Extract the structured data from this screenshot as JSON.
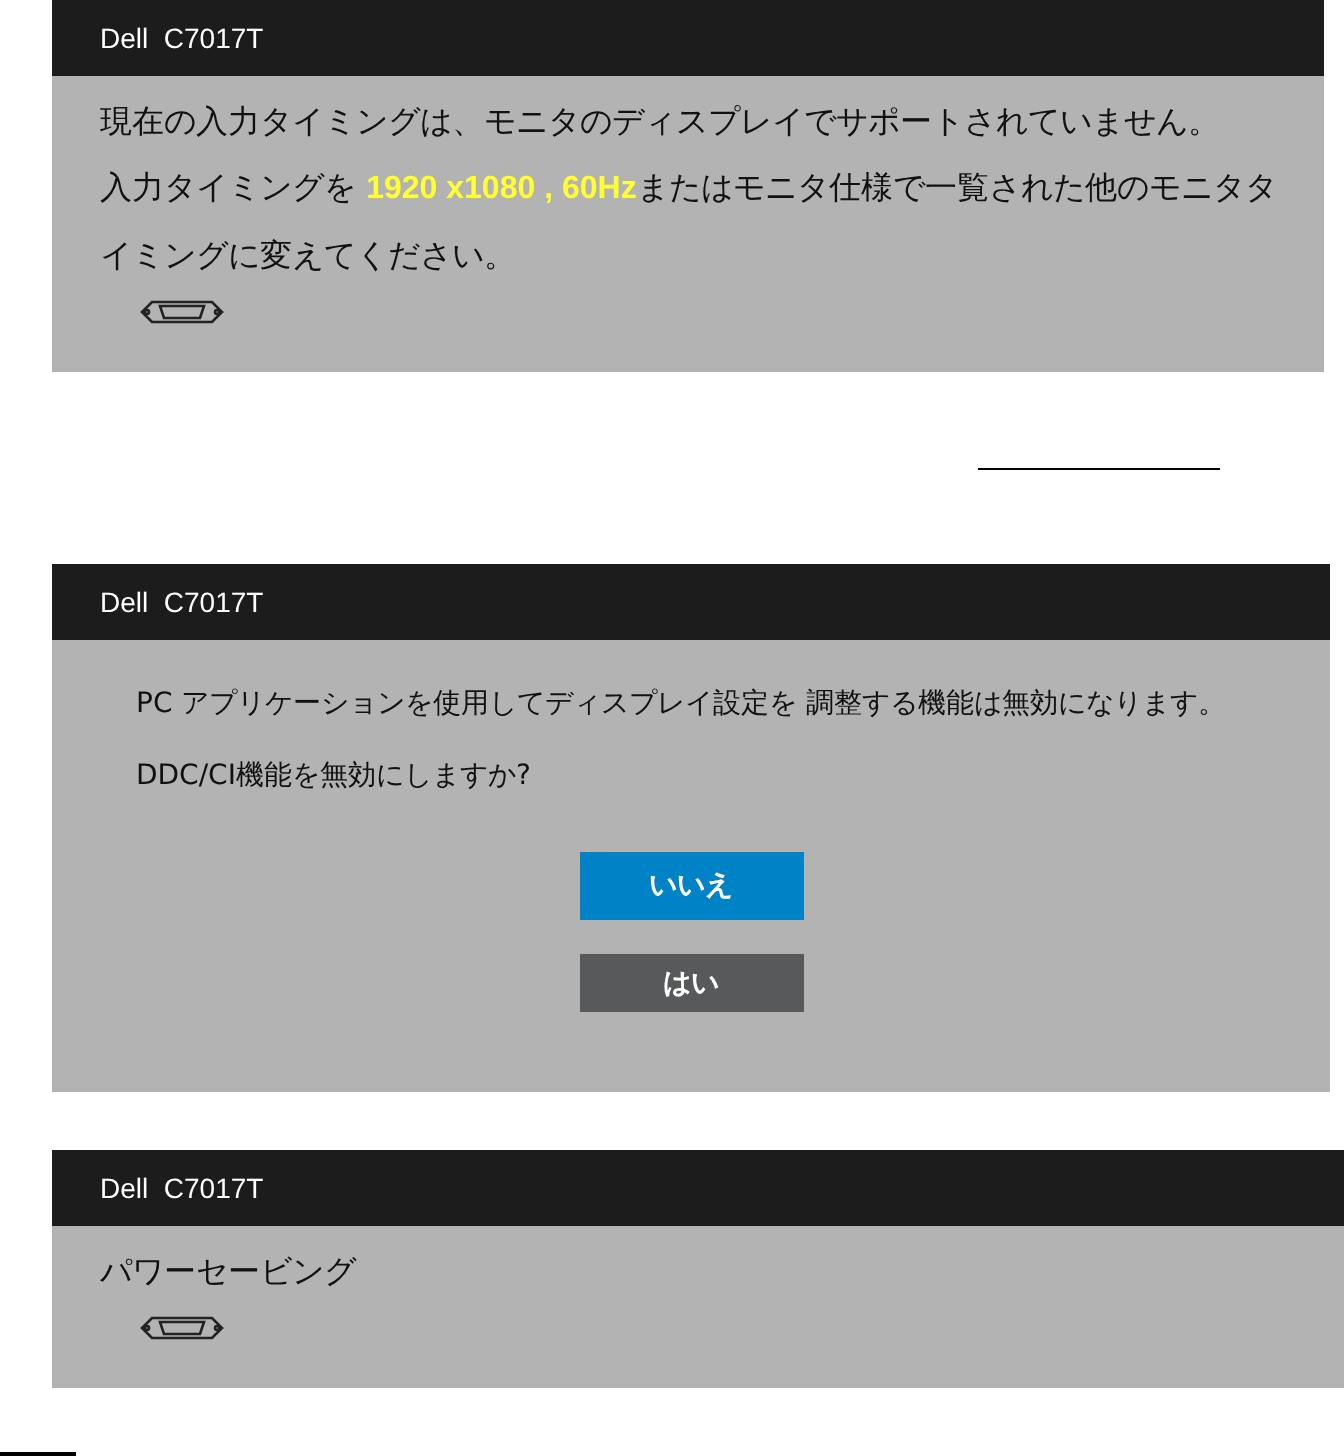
{
  "panels": [
    {
      "kind": "message",
      "title": "Dell  C7017T",
      "paragraphs": [
        [
          {
            "text": "現在の入力タイミングは、モニタのディスプレイでサポートされていません。",
            "highlight": false
          }
        ],
        [
          {
            "text": "入力タイミングを ",
            "highlight": false
          },
          {
            "text": "1920 x1080 , 60Hz",
            "highlight": true
          },
          {
            "text": "またはモニタ仕様で一覧された他のモニタタイミングに変えてください。",
            "highlight": false
          }
        ]
      ]
    },
    {
      "kind": "dialog",
      "title": "Dell  C7017T",
      "paragraphs": [
        [
          {
            "text": "PC アプリケーションを使用してディスプレイ設定を 調整する機能は無効になります。",
            "highlight": false
          }
        ],
        [
          {
            "text": "DDC/CI機能を無効にしますか?",
            "highlight": false
          }
        ]
      ],
      "buttons": [
        {
          "label": "いいえ",
          "selected": true
        },
        {
          "label": "はい",
          "selected": false
        }
      ]
    },
    {
      "kind": "message",
      "title": "Dell  C7017T",
      "paragraphs": [
        [
          {
            "text": "パワーセービング",
            "highlight": false
          }
        ]
      ]
    }
  ]
}
